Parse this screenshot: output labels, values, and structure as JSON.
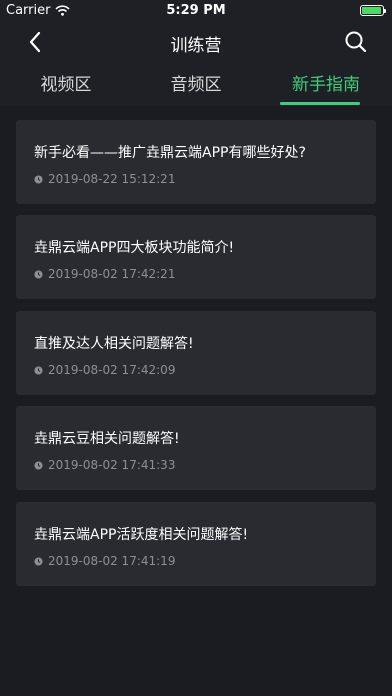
{
  "status_bar": {
    "carrier": "Carrier",
    "time": "5:29 PM",
    "battery_level": 0.95
  },
  "nav": {
    "title": "训练营"
  },
  "tabs": [
    {
      "label": "视频区",
      "active": false
    },
    {
      "label": "音频区",
      "active": false
    },
    {
      "label": "新手指南",
      "active": true
    }
  ],
  "colors": {
    "accent": "#3ccf7a",
    "background": "#1b1c21",
    "card": "#2a2b31"
  },
  "articles": [
    {
      "title": "新手必看——推广垚鼎云端APP有哪些好处?",
      "time": "2019-08-22 15:12:21"
    },
    {
      "title": "垚鼎云端APP四大板块功能简介!",
      "time": "2019-08-02 17:42:21"
    },
    {
      "title": "直推及达人相关问题解答!",
      "time": "2019-08-02 17:42:09"
    },
    {
      "title": "垚鼎云豆相关问题解答!",
      "time": "2019-08-02 17:41:33"
    },
    {
      "title": "垚鼎云端APP活跃度相关问题解答!",
      "time": "2019-08-02 17:41:19"
    }
  ]
}
